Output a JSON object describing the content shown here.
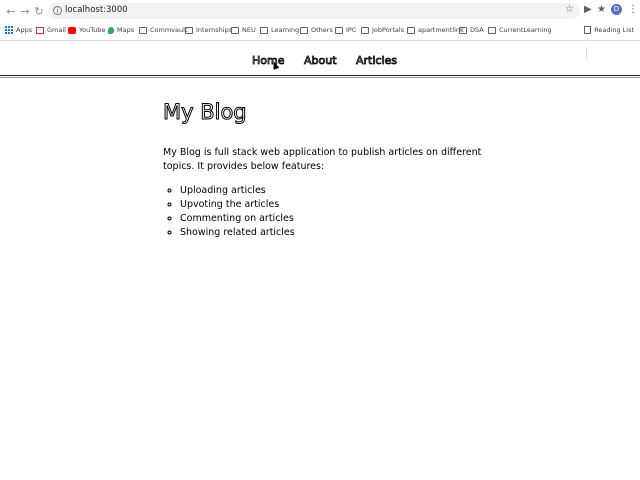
{
  "browser": {
    "url": "localhost:3000",
    "avatar_initial": "D",
    "bookmarks": [
      {
        "label": "Apps",
        "icon": "apps-icon"
      },
      {
        "label": "Gmail",
        "icon": "gmail-icon"
      },
      {
        "label": "YouTube",
        "icon": "youtube-icon"
      },
      {
        "label": "Maps",
        "icon": "maps-icon"
      },
      {
        "label": "Commvault",
        "icon": "folder-icon"
      },
      {
        "label": "Internships",
        "icon": "folder-icon"
      },
      {
        "label": "NEU",
        "icon": "folder-icon"
      },
      {
        "label": "Learning",
        "icon": "folder-icon"
      },
      {
        "label": "Others",
        "icon": "folder-icon"
      },
      {
        "label": "IPC",
        "icon": "folder-icon"
      },
      {
        "label": "JobPortals",
        "icon": "folder-icon"
      },
      {
        "label": "apartmentlink",
        "icon": "folder-icon"
      },
      {
        "label": "DSA",
        "icon": "folder-icon"
      },
      {
        "label": "CurrentLearning",
        "icon": "folder-icon"
      }
    ],
    "reading_list": "Reading List"
  },
  "site": {
    "nav": [
      "Home",
      "About",
      "Articles"
    ],
    "title": "My Blog",
    "intro": "My Blog is full stack web application to publish articles on different topics. It provides below features:",
    "features": [
      "Uploading articles",
      "Upvoting the articles",
      "Commenting on articles",
      "Showing related articles"
    ]
  },
  "colors": {
    "accent": "#1a73e8",
    "avatar": "#5c6bc0",
    "youtube": "#ff0000"
  }
}
